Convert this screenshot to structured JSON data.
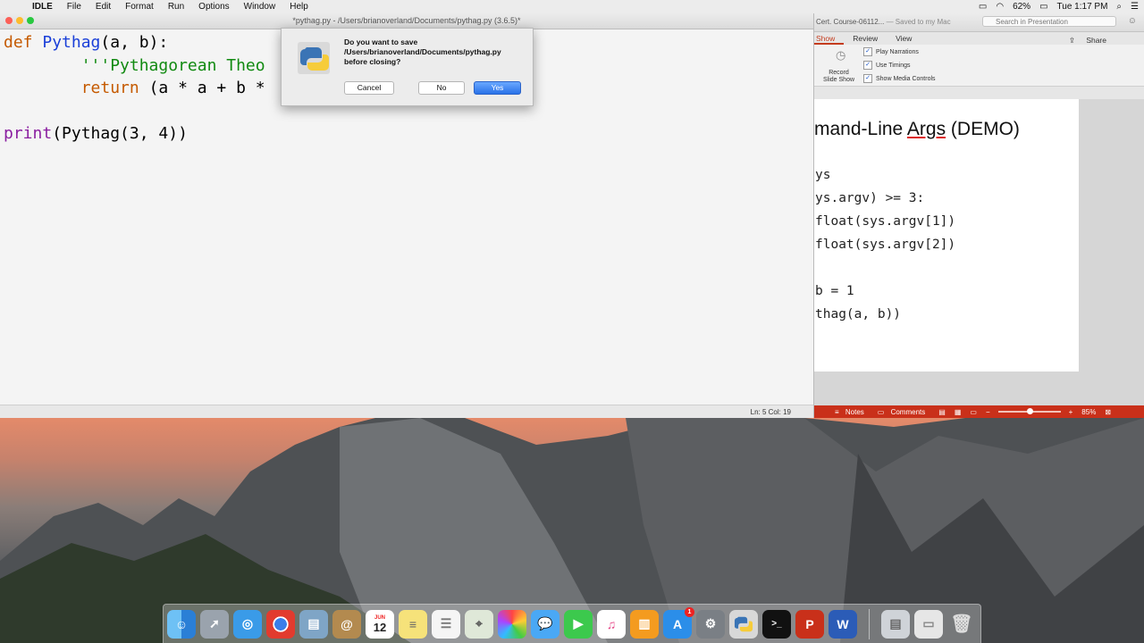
{
  "menubar": {
    "app": "IDLE",
    "items": [
      "File",
      "Edit",
      "Format",
      "Run",
      "Options",
      "Window",
      "Help"
    ],
    "battery": "62%",
    "clock": "Tue 1:17 PM"
  },
  "idle": {
    "window_title": "*pythag.py - /Users/brianoverland/Documents/pythag.py (3.6.5)*",
    "code": {
      "l1_kw": "def",
      "l1_fn": "Pythag",
      "l1_rest": "(a, b):",
      "l2_str": "'''Pythagorean Theo",
      "l3_kw": "return",
      "l3_rest": " (a * a + b *",
      "l5_bi": "print",
      "l5_rest": "(Pythag(3, 4))"
    },
    "status": "Ln: 5   Col: 19"
  },
  "dialog": {
    "message": "Do you want to save /Users/brianoverland/Documents/pythag.py before closing?",
    "cancel": "Cancel",
    "no": "No",
    "yes": "Yes"
  },
  "ppt": {
    "doc_title": "Cert. Course-06112...",
    "saved": "— Saved to my Mac",
    "search_placeholder": "Search in Presentation",
    "tabs": [
      "Show",
      "Review",
      "View"
    ],
    "share": "Share",
    "record_line1": "Record",
    "record_line2": "Slide Show",
    "options": [
      "Play Narrations",
      "Use Timings",
      "Show Media Controls"
    ],
    "slide_title_a": "mand-Line ",
    "slide_title_b": "Args",
    "slide_title_c": " (DEMO)",
    "slide_code": [
      "ys",
      "ys.argv) >= 3:",
      "float(sys.argv[1])",
      "float(sys.argv[2])",
      "",
      "b = 1",
      "thag(a, b))"
    ],
    "status": {
      "notes": "Notes",
      "comments": "Comments",
      "zoom": "85%",
      "zoom_fraction": 0.52
    }
  },
  "dock": {
    "calendar_month": "JUN",
    "calendar_day": "12",
    "appstore_badge": "1"
  },
  "colors": {
    "accent_blue": "#2a72e8",
    "ppt_red": "#c9301a",
    "keyword": "#c55a00",
    "function": "#1a3fd8",
    "string": "#118a11",
    "builtin": "#8a1ea0"
  }
}
